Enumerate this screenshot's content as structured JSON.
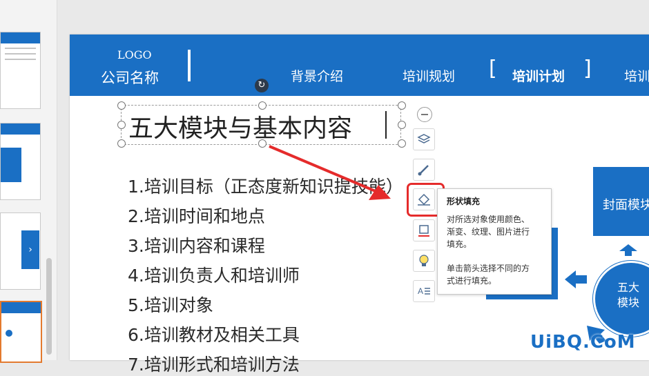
{
  "slide": {
    "header": {
      "logo": "LOGO",
      "company": "公司名称",
      "tabs": [
        "背景介绍",
        "培训规划",
        "培训计划",
        "培训"
      ],
      "active_tab_index": 2,
      "bracket_left": "[",
      "bracket_right": "]"
    },
    "title": "五大模块与基本内容",
    "list_items": [
      "1.培训目标（正态度新知识提技能）",
      "2.培训时间和地点",
      "3.培训内容和课程",
      "4.培训负责人和培训师",
      "5.培训对象",
      "6.培训教材及相关工具",
      "7.培训形式和培训方法"
    ],
    "diagram": {
      "box_label": "封面模块",
      "center_label": [
        "五大",
        "模块"
      ]
    }
  },
  "toolbar": {
    "icons": [
      "minus-icon",
      "layers-icon",
      "brush-icon",
      "shape-fill-icon",
      "outline-icon",
      "lightbulb-icon",
      "text-format-icon"
    ],
    "highlight_color": "#e52b2b"
  },
  "tooltip": {
    "title": "形状填充",
    "lines": [
      "对所选对象使用颜色、",
      "渐变、纹理、图片进行",
      "填充。",
      "单击箭头选择不同的方",
      "式进行填充。"
    ]
  },
  "watermark": "UiBQ.CoM",
  "colors": {
    "accent": "#1a6fc4",
    "arrow": "#e52b2b"
  }
}
